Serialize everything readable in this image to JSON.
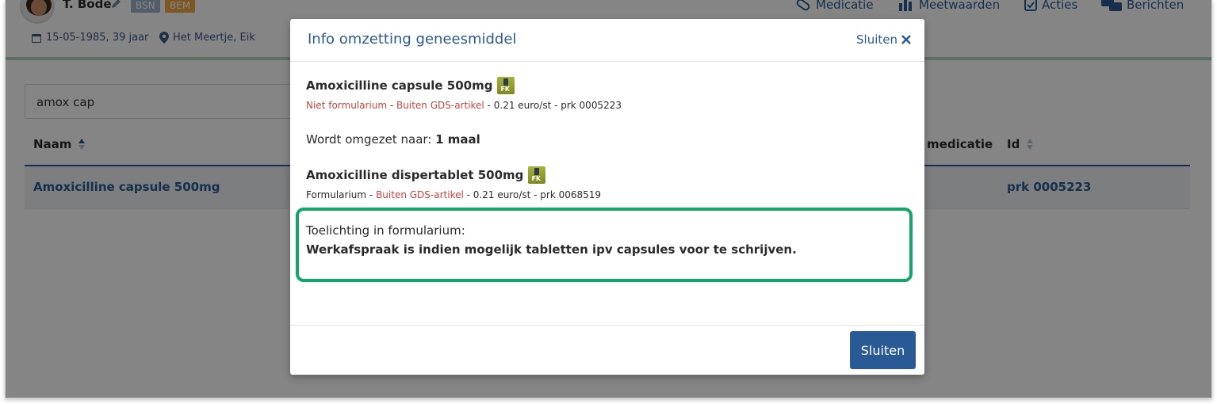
{
  "patient": {
    "name": "T. Bode",
    "badge_bsn": "BSN",
    "badge_bem": "BEM",
    "dob": "15-05-1985, 39 jaar",
    "location": "Het Meertje, Eik"
  },
  "nav": {
    "medicatie": "Medicatie",
    "meetwaarden": "Meetwaarden",
    "acties": "Acties",
    "berichten": "Berichten"
  },
  "search": {
    "value": "amox cap"
  },
  "table": {
    "headers": {
      "naam": "Naam",
      "gds": "S medicatie",
      "id": "Id"
    },
    "rows": [
      {
        "naam": "Amoxicilline capsule 500mg",
        "id": "prk 0005223"
      }
    ]
  },
  "modal": {
    "title": "Info omzetting geneesmiddel",
    "close_link": "Sluiten",
    "source": {
      "name": "Amoxicilline capsule 500mg",
      "status1": "Niet formularium",
      "status2": "Buiten GDS-artikel",
      "price": "- 0.21 euro/st - prk 0005223"
    },
    "convert_prefix": "Wordt omgezet naar: ",
    "convert_value": "1 maal",
    "target": {
      "name": "Amoxicilline dispertablet 500mg",
      "status1": "Formularium",
      "status2": "Buiten GDS-artikel",
      "price": "- 0.21 euro/st - prk 0068519"
    },
    "fk_label": "FK",
    "note_label": "Toelichting in formularium:",
    "note_text": "Werkafspraak is indien mogelijk tabletten ipv capsules voor te schrijven.",
    "close_button": "Sluiten"
  },
  "colors": {
    "accent": "#2a5a95",
    "warning": "#c9443d",
    "highlight": "#13a56a"
  }
}
